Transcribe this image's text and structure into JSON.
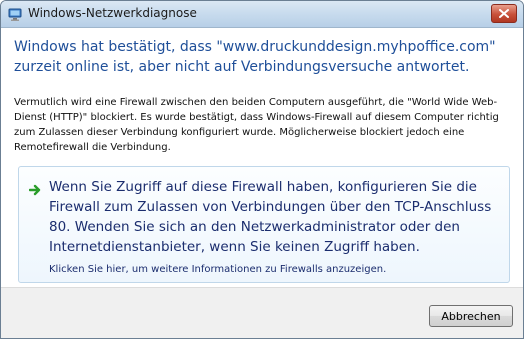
{
  "window": {
    "title": "Windows-Netzwerkdiagnose"
  },
  "icons": {
    "app": "network-diagnosis-icon",
    "close": "close-icon",
    "command": "green-arrow-icon"
  },
  "colors": {
    "instruction": "#1f4f99",
    "link": "#1b2d6e",
    "arrow": "#2a9d2a",
    "close_button": "#c8513a"
  },
  "main_instruction": "Windows hat bestätigt, dass \"www.druckunddesign.myhpoffice.com\" zurzeit online ist, aber nicht auf Verbindungsversuche antwortet.",
  "description": "Vermutlich wird eine Firewall zwischen den beiden Computern ausgeführt, die \"World Wide Web-Dienst (HTTP)\" blockiert. Es wurde bestätigt, dass Windows-Firewall auf diesem Computer richtig zum Zulassen dieser Verbindung konfiguriert wurde. Möglicherweise blockiert jedoch eine Remotefirewall die Verbindung.",
  "command_link": {
    "text": "Wenn Sie Zugriff auf diese Firewall haben, konfigurieren Sie die Firewall zum Zulassen von Verbindungen über den TCP-Anschluss 80. Wenden Sie sich an den Netzwerkadministrator oder den Internetdienstanbieter, wenn Sie keinen Zugriff haben.",
    "note": "Klicken Sie hier, um weitere Informationen zu Firewalls anzuzeigen."
  },
  "buttons": {
    "cancel": "Abbrechen"
  }
}
